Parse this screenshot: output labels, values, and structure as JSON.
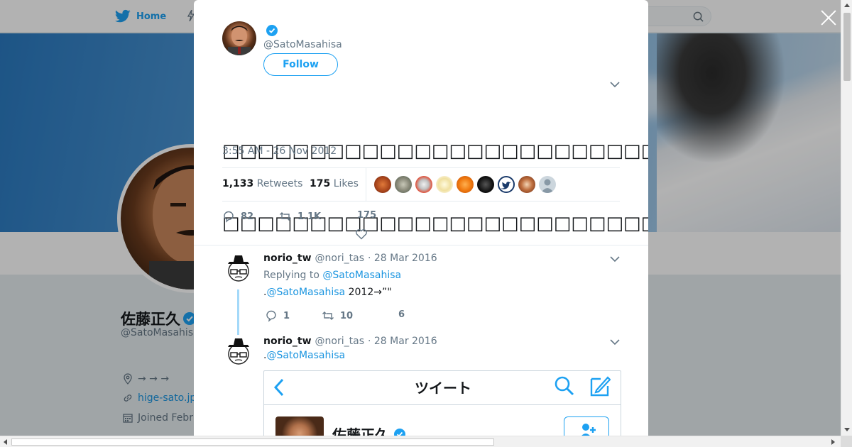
{
  "nav": {
    "home_label": "Home"
  },
  "profile": {
    "name": "佐藤正久",
    "handle": "@SatoMasahisa",
    "location": "→ → →",
    "website": "hige-sato.jp",
    "joined": "Joined Februa"
  },
  "tweet": {
    "handle": "@SatoMasahisa",
    "follow_label": "Follow",
    "text_line1": "□□□□□□□□□□□□□□□□□□□□□□□□□□□□□□□CM□□□□□□□□□□□□□□□□□□□□□□□□□□□□□□□□□",
    "text_line2": "□□□□□□□□□□□□□□□□□□□□□□□□□□□□□□□□□□□□□□□□□□□□□□□□□□□□",
    "timestamp": "3:55 AM - 26 Nov 2012",
    "retweets_count": "1,133",
    "retweets_label": "Retweets",
    "likes_count": "175",
    "likes_label": "Likes",
    "actions": {
      "replies": "82",
      "retweets": "1.1K",
      "likes": "175"
    }
  },
  "replies": [
    {
      "name": "norio_tw",
      "handle": "@nori_tas",
      "date": "· 28 Mar 2016",
      "replying_prefix": "Replying to",
      "replying_to": "@SatoMasahisa",
      "text_prefix": ".",
      "text_mention": "@SatoMasahisa",
      "text_suffix": " 2012→”\"",
      "actions": {
        "replies": "1",
        "retweets": "10",
        "likes": "6"
      }
    },
    {
      "name": "norio_tw",
      "handle": "@nori_tas",
      "date": "· 28 Mar 2016",
      "text_prefix": ".",
      "text_mention": "@SatoMasahisa",
      "embed_title": "ツイート",
      "embed_name": "佐藤正久"
    }
  ],
  "colors": {
    "accent": "#1da1f2",
    "link": "#1b95e0",
    "thread": "#a4d9f9"
  }
}
